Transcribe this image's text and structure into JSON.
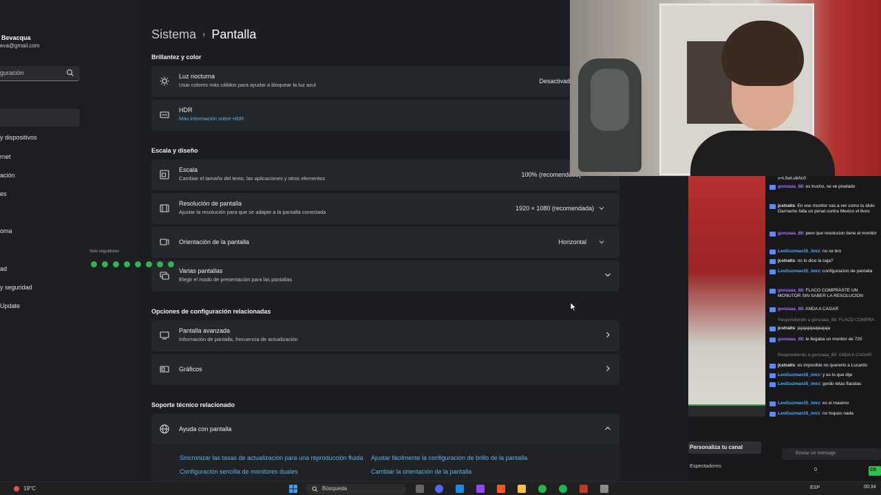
{
  "sidebar": {
    "user_name": "Bevacqua",
    "user_email": "eva@gmail.com",
    "search_placeholder": "guración",
    "items": [
      {
        "label": "y dispositivos",
        "top": 0
      },
      {
        "label": "rnet"
      },
      {
        "label": "ación"
      },
      {
        "label": "es"
      },
      {
        "label": "oma"
      },
      {
        "label": "ad"
      },
      {
        "label": "y seguridad"
      },
      {
        "label": "Update"
      }
    ]
  },
  "header": {
    "crumb": "Sistema",
    "separator": "›",
    "title": "Pantalla"
  },
  "sections": {
    "brightness": "Brillantez y color",
    "scale": "Escala y diseño",
    "related": "Opciones de configuración relacionadas",
    "support": "Soporte técnico relacionado"
  },
  "cards": {
    "night_light": {
      "label": "Luz nocturna",
      "sub": "Usar colores más cálidos para ayudar a bloquear la luz azul",
      "value": "Desactivad"
    },
    "hdr": {
      "label": "HDR",
      "link": "Más información sobre HDR"
    },
    "scale": {
      "label": "Escala",
      "sub": "Cambiar el tamaño del texto, las aplicaciones y otros elementos",
      "value": "100% (recomendado)"
    },
    "resolution": {
      "label": "Resolución de pantalla",
      "sub": "Ajustar la resolución para que se adapte a la pantalla conectada",
      "value": "1920 × 1080 (recomendada)"
    },
    "orientation": {
      "label": "Orientación de la pantalla",
      "value": "Horizontal"
    },
    "multi": {
      "label": "Varias pantallas",
      "sub": "Elegir el modo de presentación para las pantallas"
    },
    "advanced": {
      "label": "Pantalla avanzada",
      "sub": "Información de pantalla, frecuencia de actualización"
    },
    "graphics": {
      "label": "Gráficos"
    },
    "help": {
      "label": "Ayuda con pantalla"
    }
  },
  "help_links": [
    "Sincronizar las tasas de actualización para una reproducción fluida",
    "Ajustar fácilmente la configuración de brillo de la pantalla",
    "Configuración sencilla de monitores duales",
    "Cambiar la orientación de la pantalla"
  ],
  "chat": {
    "top_fragment": "v=L5wLvikhc0",
    "messages": [
      {
        "user": "gonzaaa_88",
        "text": "es trucho, se ve pixelado",
        "color": "g"
      },
      {
        "user": "jcstraits",
        "text": "En ese monitor vas a ver como tu idolo Garnacho falla un penal contra Mexico el 8vos",
        "color": "w"
      },
      {
        "user": "gonzaaa_88",
        "text": "pero que resolucion tiene el monitor",
        "color": "g"
      },
      {
        "user": "LeoGuzman15_imrz",
        "text": "no se bro",
        "color": "b"
      },
      {
        "user": "jcstraits",
        "text": "no lo dice la caja?",
        "color": "w"
      },
      {
        "user": "LeoGuzman15_imrz",
        "text": "configuracion de pantalla",
        "color": "b"
      },
      {
        "user": "gonzaaa_88",
        "text": "FLACO COMPRASTE UN MONUTOR SIN SABER LA RESOLUCION",
        "color": "g"
      },
      {
        "user": "gonzaaa_88",
        "text": "ANDA A CAGAR",
        "color": "g"
      },
      {
        "reply": "Respondiendo a gonzaaa_88: FLACO COMPRA"
      },
      {
        "user": "jcstraits",
        "text": "jajajajajaajaajaja",
        "color": "w"
      },
      {
        "user": "gonzaaa_88",
        "text": "le llegaba un monitor de 720",
        "color": "g"
      },
      {
        "reply": "Respondiendo a gonzaaa_88: ANDA A CAGAR"
      },
      {
        "user": "jcstraits",
        "text": "es imposible no quererlo a Lucardo",
        "color": "w"
      },
      {
        "user": "LeoGuzman15_imrz",
        "text": "y es lo que dije",
        "color": "b"
      },
      {
        "user": "LeoGuzman15_imrz",
        "text": "gordo tetas flacidas",
        "color": "b"
      },
      {
        "user": "LeoGuzman15_imrz",
        "text": "es el maximo",
        "color": "b"
      },
      {
        "user": "LeoGuzman15_imrz",
        "text": "no toques nada",
        "color": "b"
      }
    ],
    "followers_only": "Solo seguidores",
    "input_placeholder": "Enviar un mensaje",
    "chat_button": "Ch",
    "points": "0"
  },
  "stream_panel": {
    "customize": "Personaliza tu canal",
    "viewers": "Espectadores"
  },
  "taskbar": {
    "weather": "19°C",
    "search": "Búsqueda",
    "lang": "ESP",
    "time": "00:34"
  }
}
